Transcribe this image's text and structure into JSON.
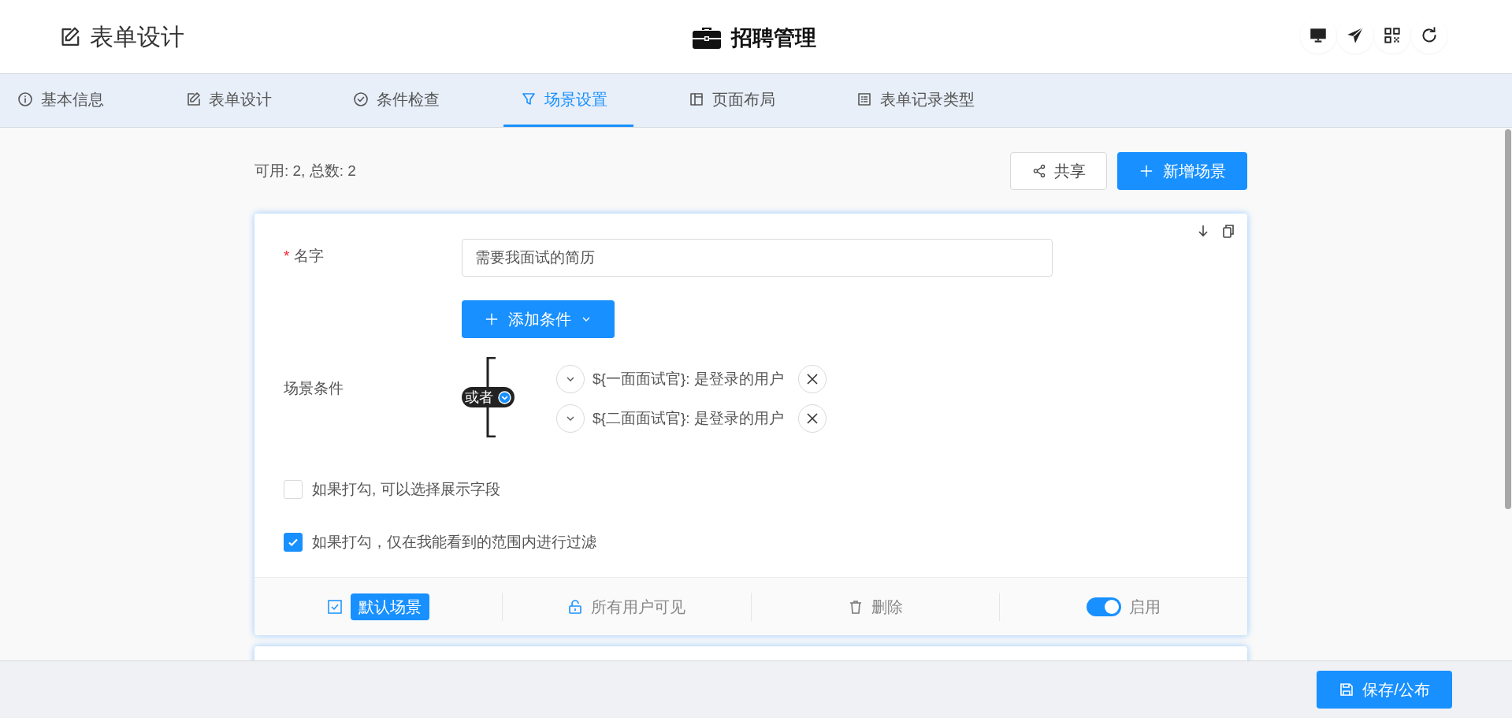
{
  "header": {
    "title": "表单设计",
    "app_title": "招聘管理"
  },
  "tabs": [
    {
      "label": "基本信息",
      "selected": false
    },
    {
      "label": "表单设计",
      "selected": false
    },
    {
      "label": "条件检查",
      "selected": false
    },
    {
      "label": "场景设置",
      "selected": true
    },
    {
      "label": "页面布局",
      "selected": false
    },
    {
      "label": "表单记录类型",
      "selected": false
    }
  ],
  "summary": "可用: 2, 总数: 2",
  "share_button": "共享",
  "add_scene_button": "新增场景",
  "scene": {
    "name_label": "名字",
    "required_mark": "*",
    "name_value": "需要我面试的简历",
    "add_condition_button": "添加条件",
    "conditions_label": "场景条件",
    "operator": "或者",
    "conditions": [
      {
        "text": "${一面面试官}: 是登录的用户"
      },
      {
        "text": "${二面面试官}: 是登录的用户"
      }
    ],
    "options": [
      {
        "label": "如果打勾, 可以选择展示字段",
        "checked": false
      },
      {
        "label": "如果打勾，仅在我能看到的范围内进行过滤",
        "checked": true
      }
    ],
    "default_label": "默认场景",
    "default_checked": true,
    "visibility": "所有用户可见",
    "delete": "删除",
    "enabled": {
      "label": "启用",
      "on": true
    }
  },
  "save_button": "保存/公布"
}
